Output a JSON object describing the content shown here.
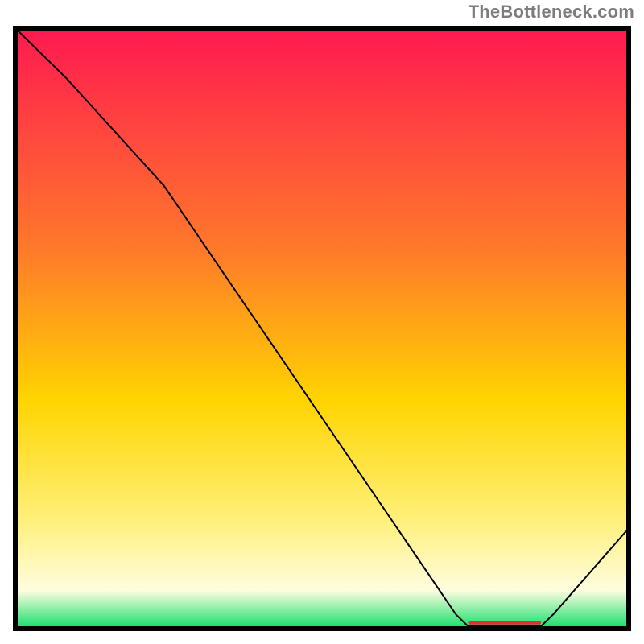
{
  "watermark": "TheBottleneck.com",
  "colors": {
    "border": "#000000",
    "line": "#000000",
    "gradient_top": "#ff1a50",
    "gradient_mid1": "#ff7a2a",
    "gradient_mid2": "#ffd400",
    "gradient_mid3": "#fff07a",
    "gradient_mid4": "#fffde0",
    "gradient_bottom": "#20e070",
    "marker": "#e62e2e"
  },
  "chart_data": {
    "type": "line",
    "title": "",
    "xlabel": "",
    "ylabel": "",
    "xlim": [
      0,
      100
    ],
    "ylim": [
      0,
      100
    ],
    "x": [
      0,
      8,
      24,
      72,
      74,
      86,
      88,
      100
    ],
    "values": [
      100,
      92,
      74,
      2,
      0,
      0,
      2,
      16
    ],
    "optimum_band": {
      "x_start": 74,
      "x_end": 86,
      "y": 0
    }
  }
}
